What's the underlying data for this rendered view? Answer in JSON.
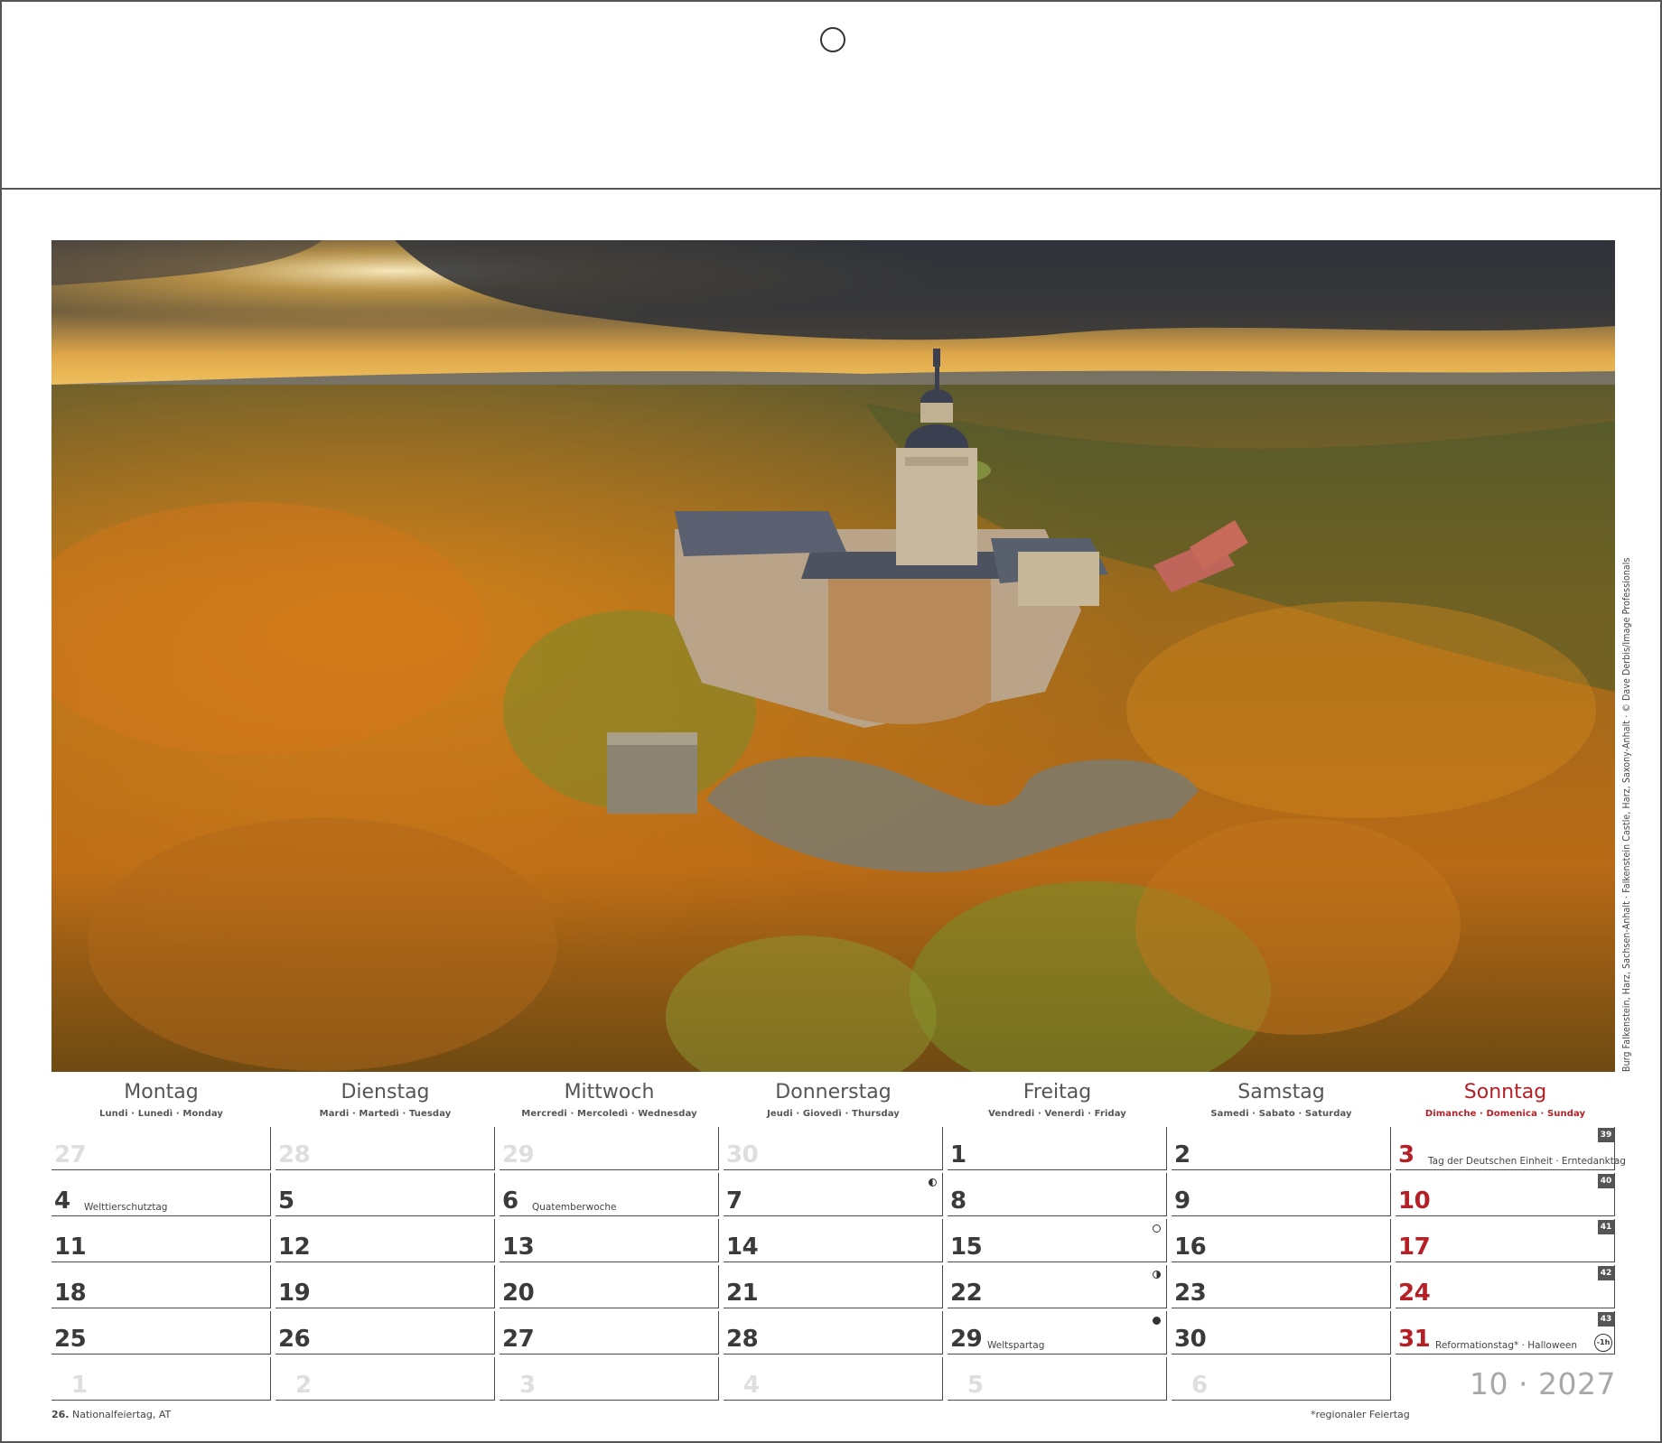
{
  "photo": {
    "caption": "Burg Falkenstein, Harz, Sachsen-Anhalt · Falkenstein Castle, Harz, Saxony-Anhalt · © Dave Derbis/Image Professionals"
  },
  "weekdays": [
    {
      "name": "Montag",
      "sub": "Lundi · Lunedì · Monday"
    },
    {
      "name": "Dienstag",
      "sub": "Mardi · Martedì · Tuesday"
    },
    {
      "name": "Mittwoch",
      "sub": "Mercredi · Mercoledì · Wednesday"
    },
    {
      "name": "Donnerstag",
      "sub": "Jeudi · Giovedì · Thursday"
    },
    {
      "name": "Freitag",
      "sub": "Vendredi · Venerdì · Friday"
    },
    {
      "name": "Samstag",
      "sub": "Samedi · Sabato · Saturday"
    },
    {
      "name": "Sonntag",
      "sub": "Dimanche · Domenica · Sunday"
    }
  ],
  "weeks": [
    {
      "kw": "39",
      "days": [
        {
          "d": "27",
          "other": true
        },
        {
          "d": "28",
          "other": true
        },
        {
          "d": "29",
          "other": true
        },
        {
          "d": "30",
          "other": true
        },
        {
          "d": "1"
        },
        {
          "d": "2"
        },
        {
          "d": "3",
          "note": "Tag der Deutschen Einheit · Erntedanktag"
        }
      ]
    },
    {
      "kw": "40",
      "days": [
        {
          "d": "4",
          "note": "Welttierschutztag"
        },
        {
          "d": "5"
        },
        {
          "d": "6",
          "note": "Quatemberwoche"
        },
        {
          "d": "7",
          "moon": "last"
        },
        {
          "d": "8"
        },
        {
          "d": "9"
        },
        {
          "d": "10"
        }
      ]
    },
    {
      "kw": "41",
      "days": [
        {
          "d": "11"
        },
        {
          "d": "12"
        },
        {
          "d": "13"
        },
        {
          "d": "14"
        },
        {
          "d": "15",
          "moon": "full"
        },
        {
          "d": "16"
        },
        {
          "d": "17"
        }
      ]
    },
    {
      "kw": "42",
      "days": [
        {
          "d": "18"
        },
        {
          "d": "19"
        },
        {
          "d": "20"
        },
        {
          "d": "21"
        },
        {
          "d": "22",
          "moon": "first"
        },
        {
          "d": "23"
        },
        {
          "d": "24"
        }
      ]
    },
    {
      "kw": "43",
      "days": [
        {
          "d": "25"
        },
        {
          "d": "26"
        },
        {
          "d": "27"
        },
        {
          "d": "28"
        },
        {
          "d": "29",
          "note": "Weltspartag",
          "moon": "new"
        },
        {
          "d": "30"
        },
        {
          "d": "31",
          "note": "Reformationstag* · Halloween",
          "dst": "-1h"
        }
      ]
    },
    {
      "kw": "",
      "days": [
        {
          "d": "1",
          "other": true
        },
        {
          "d": "2",
          "other": true
        },
        {
          "d": "3",
          "other": true
        },
        {
          "d": "4",
          "other": true
        },
        {
          "d": "5",
          "other": true
        },
        {
          "d": "6",
          "other": true
        },
        {
          "d": "",
          "blank": true
        }
      ]
    }
  ],
  "month_label": "10 · 2027",
  "footer": {
    "left_day": "26.",
    "left_text": "Nationalfeiertag, AT",
    "right_text": "*regionaler Feiertag"
  },
  "colors": {
    "sunday": "#b52027",
    "text": "#3a3a3a",
    "muted": "#dedede"
  }
}
